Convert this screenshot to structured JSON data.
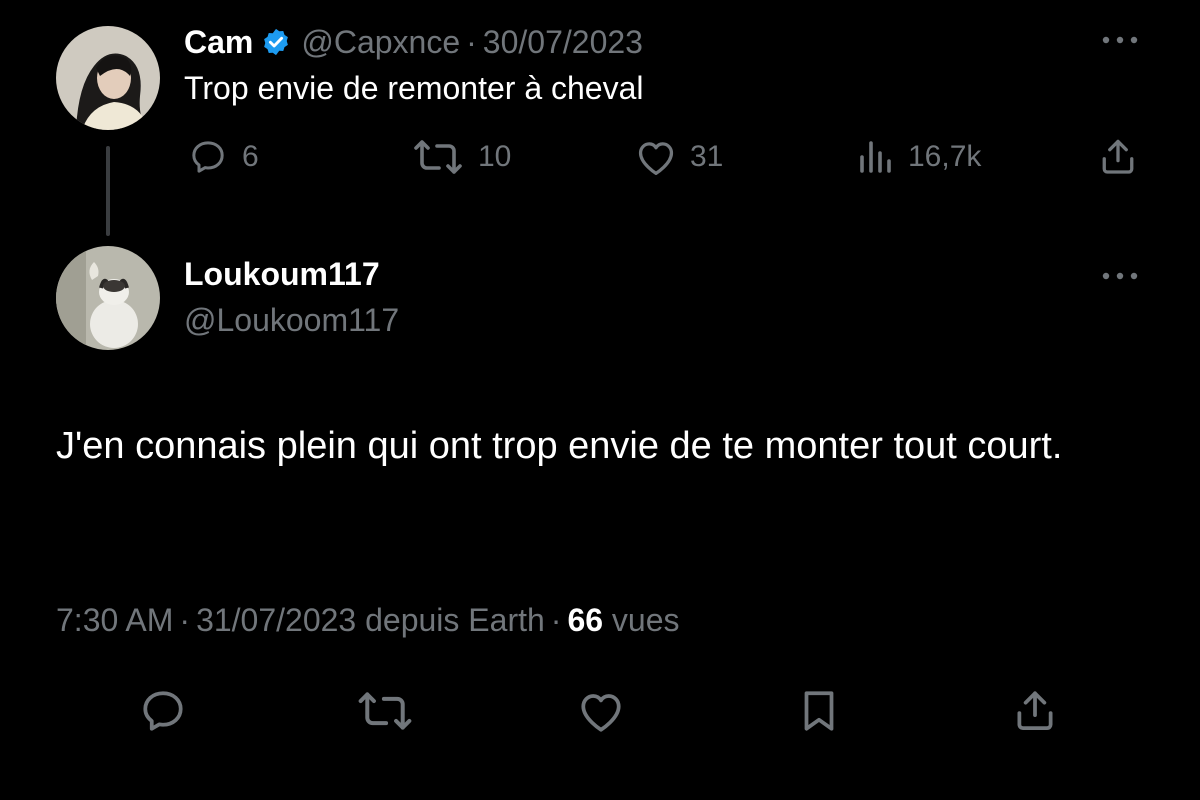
{
  "original_tweet": {
    "author_name": "Cam",
    "verified": true,
    "handle": "@Capxnce",
    "separator": "·",
    "date": "30/07/2023",
    "text": "Trop envie de remonter à cheval",
    "stats": {
      "replies": "6",
      "retweets": "10",
      "likes": "31",
      "views": "16,7k"
    }
  },
  "reply_tweet": {
    "author_name": "Loukoum117",
    "handle": "@Loukoom117",
    "text": "J'en connais plein qui ont trop envie de te monter tout court.",
    "meta": {
      "time": "7:30 AM",
      "date": "31/07/2023",
      "source": "depuis Earth",
      "view_count": "66",
      "view_label": "vues"
    }
  },
  "colors": {
    "background": "#000000",
    "primary_text": "#ffffff",
    "secondary_text": "#71767b",
    "verified_badge": "#1d9bf0",
    "thread_line": "#3a3d40"
  },
  "icons": {
    "reply": "speech-bubble-icon",
    "retweet": "retweet-arrows-icon",
    "like": "heart-outline-icon",
    "views": "bar-chart-icon",
    "share": "share-upload-icon",
    "bookmark": "bookmark-icon",
    "more": "ellipsis-icon",
    "verified": "verified-badge-icon"
  }
}
